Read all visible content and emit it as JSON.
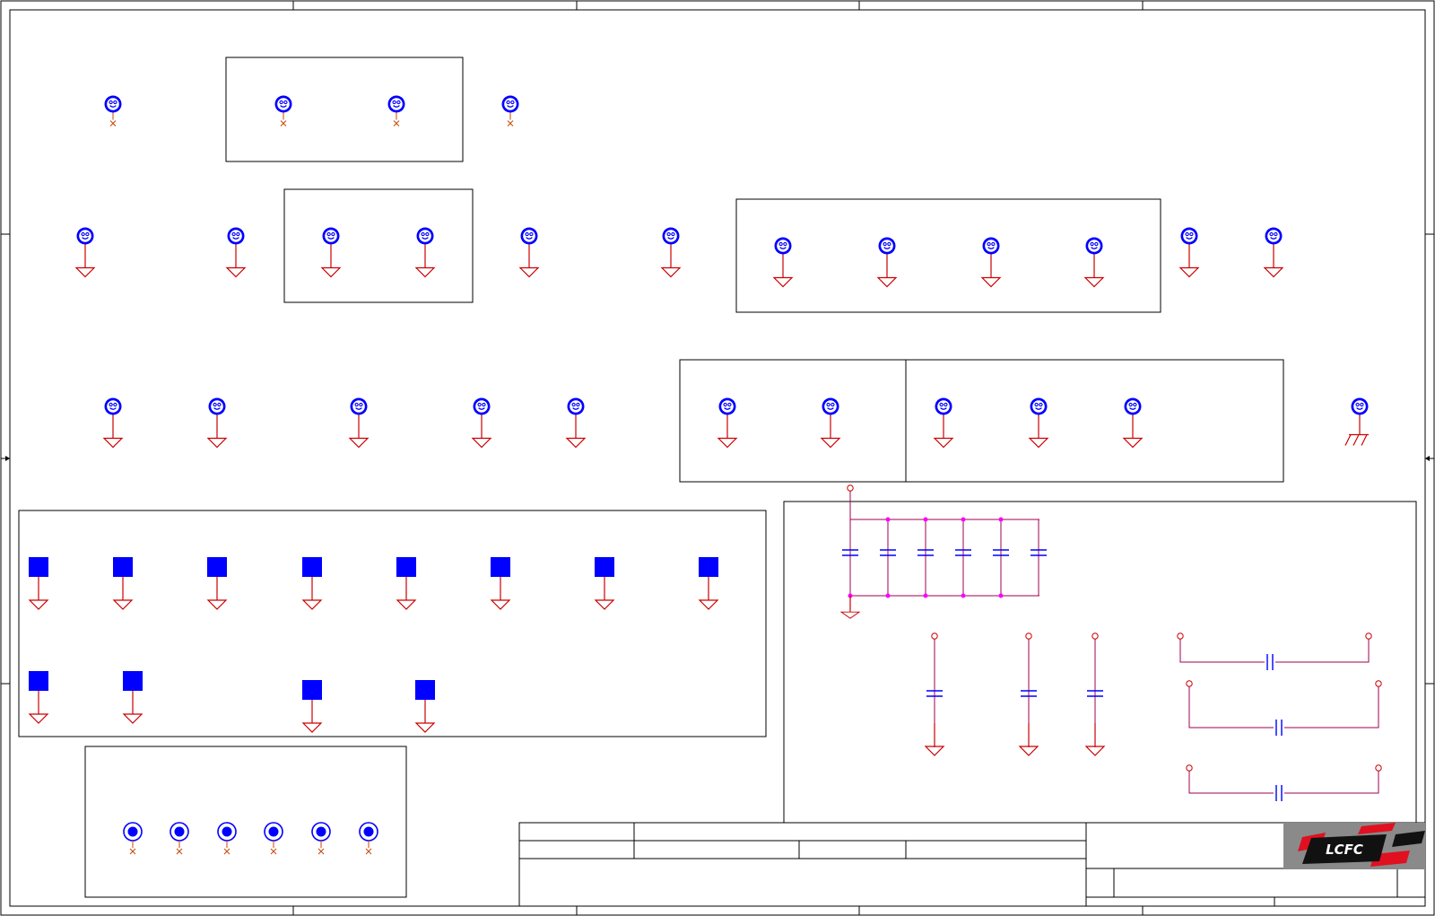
{
  "sheet": {
    "background": "#ffffff",
    "frame_color": "#000000",
    "symbol_color": "#0000ff",
    "wire_color": "#cc0000",
    "cap_wire_color": "#a00050",
    "junction_color": "#ff00ff",
    "nc_color": "#cc4400"
  },
  "symbols": {
    "mounting_hole": "smiley-hole-icon",
    "ground": "ground-triangle-icon",
    "chassis_ground": "chassis-ground-icon",
    "no_connect": "x-mark-icon",
    "test_pad": "square-pad-icon",
    "fiducial": "ring-fiducial-icon",
    "capacitor": "capacitor-icon"
  },
  "title_block": {
    "logo_text": "LCFC",
    "logo_colors": {
      "red": "#e01020",
      "black": "#111111",
      "gray": "#8a8a8a"
    }
  }
}
